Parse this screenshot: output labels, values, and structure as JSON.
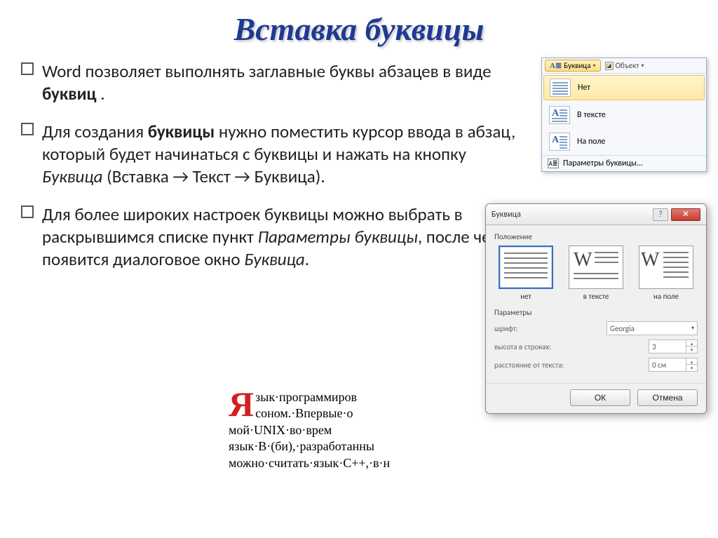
{
  "title": "Вставка буквицы",
  "bullets": {
    "p1a": "Word позволяет выполнять заглавные буквы абзацев в виде ",
    "p1b": "буквиц",
    "p1c": " .",
    "p2a": "Для создания ",
    "p2b": "буквицы",
    "p2c": " нужно поместить курсор ввода в абзац, который будет начинаться с буквицы и нажать на кнопку ",
    "p2d": "Буквица",
    "p2e": " (Вставка → Текст → Буквица).",
    "p3a": "Для более широких настроек буквицы можно выбрать в раскрывшимся списке пункт ",
    "p3b": "Параметры буквицы",
    "p3c": ", после чего появится диалоговое окно ",
    "p3d": "Буквица",
    "p3e": "."
  },
  "ribbon": {
    "dropcap_btn": "Буквица",
    "object_btn": "Объект",
    "opt_none": "Нет",
    "opt_intext": "В тексте",
    "opt_margin": "На поле",
    "opt_params": "Параметры буквицы..."
  },
  "dlg": {
    "title": "Буквица",
    "group_position": "Положение",
    "pos_none": "нет",
    "pos_intext": "в тексте",
    "pos_margin": "на поле",
    "group_params": "Параметры",
    "label_font": "шрифт:",
    "font_value": "Georgia",
    "label_height": "высота в строках:",
    "height_value": "3",
    "label_distance": "расстояние от текста:",
    "distance_value": "0 см",
    "ok": "ОК",
    "cancel": "Отмена"
  },
  "sample": {
    "drop": "Я",
    "l1": "зык·программиров",
    "l2": "соном.·Впервые·о",
    "l3": "мой·UNIX·во·врем",
    "l4": "язык·B·(би),·разработанны",
    "l5": "можно·считать·язык·C++,·в·н"
  }
}
